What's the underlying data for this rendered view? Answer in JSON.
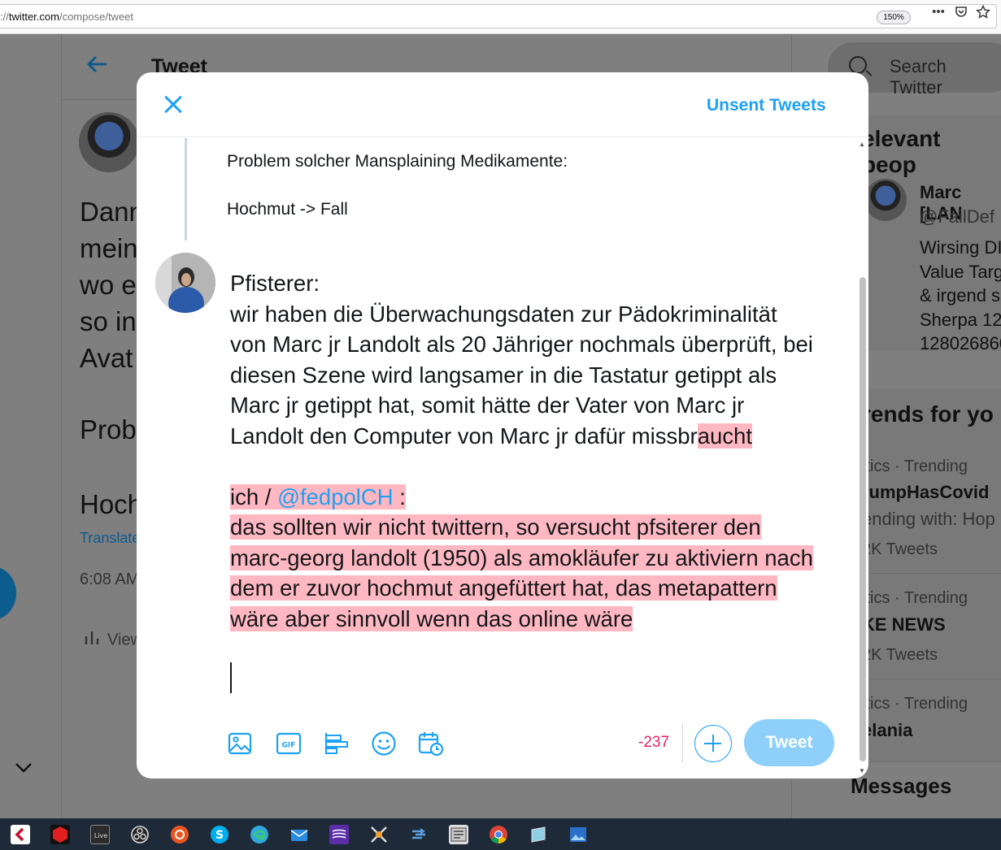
{
  "browser": {
    "url_prefix": "://",
    "url_domain": "twitter.com",
    "url_path": "/compose/tweet",
    "zoom": "150%"
  },
  "background": {
    "page_title": "Tweet",
    "tweet_text": [
      "Dann",
      "mein",
      "wo e",
      "so in",
      "Avat"
    ],
    "prob_text": "Prob",
    "hoch_text": "Hoch",
    "translate_label": "Translate",
    "time_text": "6:08 AM",
    "views_label": "View",
    "search_placeholder": "Search Twitter",
    "relevant_title": "elevant peop",
    "relevant_person": {
      "name": "Marc [LAN",
      "handle": "@FailDef",
      "bio": [
        "Wirsing DI",
        "Value Targ",
        "& irgend s",
        "Sherpa 12",
        "128026860"
      ]
    },
    "trends_title": "rends for yo",
    "trends": [
      {
        "meta": "itics · Trending",
        "name": "rumpHasCovid",
        "extra": "ending with: Hop",
        "count": "2K Tweets"
      },
      {
        "meta": "itics · Trending",
        "name": "KE NEWS",
        "extra": "",
        "count": "2K Tweets"
      },
      {
        "meta": "itics · Trending",
        "name": "elania",
        "extra": "",
        "count": ""
      }
    ],
    "messages_label": "Messages"
  },
  "modal": {
    "unsent_tweets_label": "Unsent Tweets",
    "quoted": {
      "line1": "Problem solcher Mansplaining Medikamente:",
      "line2": "Hochmut -> Fall"
    },
    "composer": {
      "lines": [
        "Pfisterer:",
        "wir haben die Überwachungsdaten zur Pädokriminalität",
        "von Marc jr Landolt als 20 Jähriger nochmals überprüft, bei",
        "diesen Szene wird langsamer in die Tastatur getippt als",
        "Marc jr getippt hat, somit hätte der Vater von Marc jr"
      ],
      "line6_normal": "Landolt den Computer von Marc jr dafür missbr",
      "line6_highlight": "aucht",
      "ich_prefix": "ich / ",
      "mention": "@fedpolCH",
      "ich_suffix": " :",
      "highlighted_lines": [
        "das sollten wir nicht twittern, so versucht pfsiterer den",
        "marc-georg landolt (1950) als amokläufer zu aktiviern nach",
        "dem er zuvor hochmut angefüttert hat, das metapattern",
        "wäre aber sinnvoll wenn das online wäre"
      ]
    },
    "char_count": "-237",
    "tweet_button_label": "Tweet",
    "toolbar_icons": [
      "image-icon",
      "gif-icon",
      "poll-icon",
      "emoji-icon",
      "schedule-icon"
    ]
  },
  "colors": {
    "accent": "#1da1f2",
    "highlight": "#ffb8c1",
    "over_limit": "#e0245e"
  }
}
